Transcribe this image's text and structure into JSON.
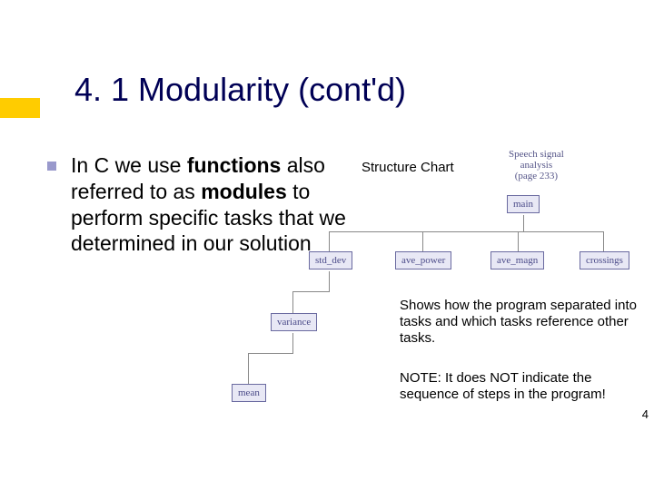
{
  "title": "4. 1 Modularity (cont'd)",
  "body_parts": {
    "p1": "In C we use ",
    "b1": "functions",
    "p2": " also referred to as ",
    "b2": "modules",
    "p3": " to perform specific tasks that we determined in our solution"
  },
  "chart_label": "Structure Chart",
  "speech_caption_l1": "Speech signal",
  "speech_caption_l2": "analysis",
  "speech_caption_l3": "(page 233)",
  "nodes": {
    "main": "main",
    "std_dev": "std_dev",
    "ave_power": "ave_power",
    "ave_magn": "ave_magn",
    "crossings": "crossings",
    "variance": "variance",
    "mean": "mean"
  },
  "shows_text": "Shows how the program separated into tasks and which tasks reference other tasks.",
  "note_text": "NOTE: It does NOT indicate the sequence of steps in the program!",
  "page_num": "4"
}
